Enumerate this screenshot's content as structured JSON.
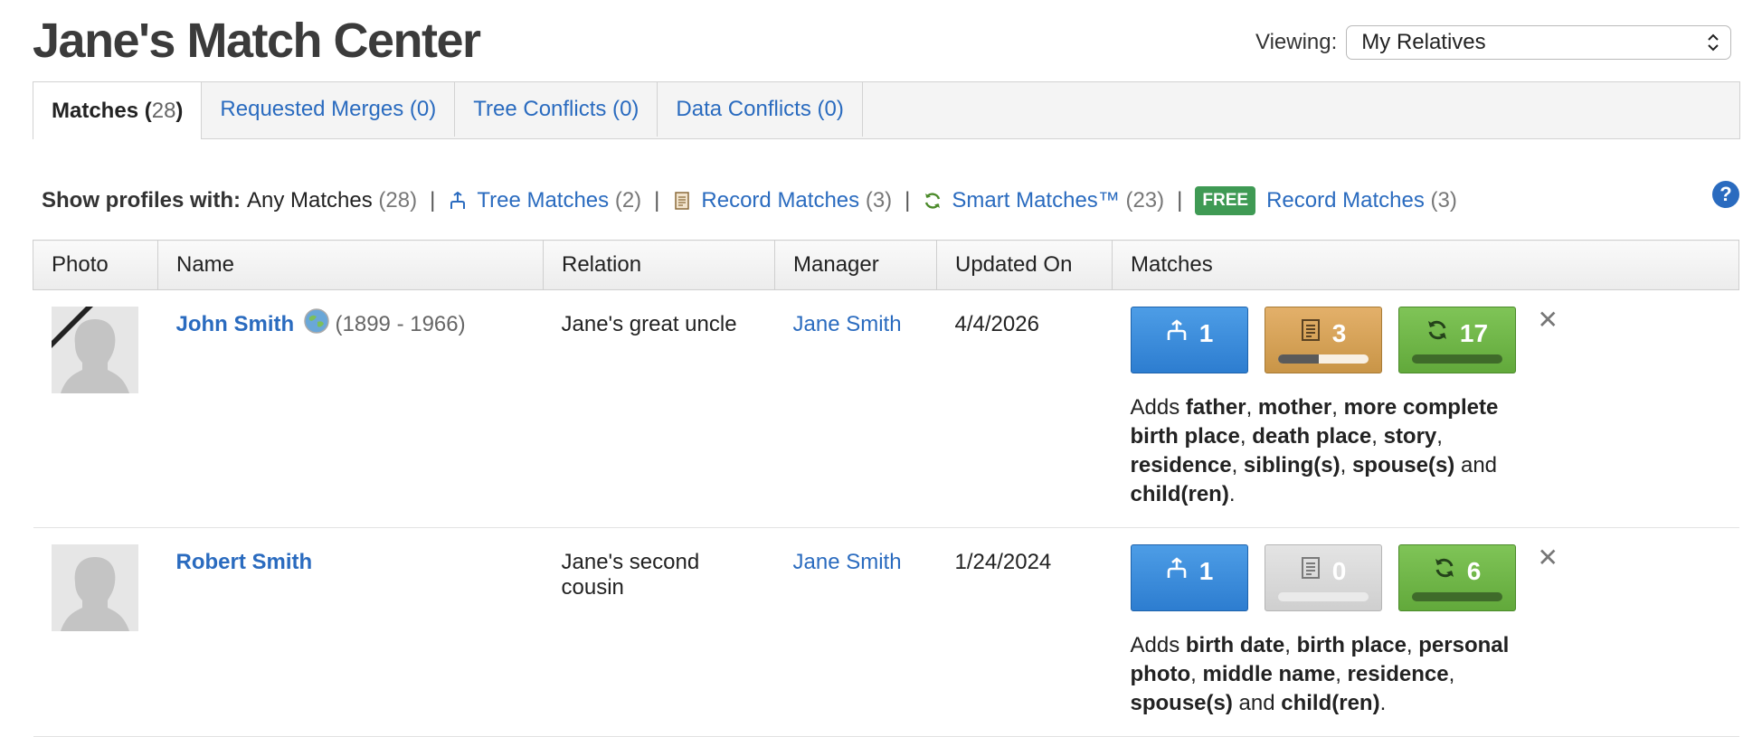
{
  "page_title": "Jane's Match Center",
  "viewing": {
    "label": "Viewing:",
    "selected": "My Relatives"
  },
  "tabs": [
    {
      "label": "Matches",
      "count": "28"
    },
    {
      "label": "Requested Merges",
      "count": "0"
    },
    {
      "label": "Tree Conflicts",
      "count": "0"
    },
    {
      "label": "Data Conflicts",
      "count": "0"
    }
  ],
  "filters": {
    "label": "Show profiles with:",
    "any": {
      "label": "Any Matches",
      "count": "(28)"
    },
    "tree": {
      "label": "Tree Matches",
      "count": "(2)"
    },
    "record": {
      "label": "Record Matches",
      "count": "(3)"
    },
    "smart": {
      "label": "Smart Matches™",
      "count": "(23)"
    },
    "free_badge": "FREE",
    "free_record": {
      "label": "Record Matches",
      "count": "(3)"
    },
    "separator": "|"
  },
  "help_label": "?",
  "table": {
    "headers": [
      "Photo",
      "Name",
      "Relation",
      "Manager",
      "Updated On",
      "Matches"
    ],
    "rows": [
      {
        "name": "John Smith",
        "years": "(1899 - 1966)",
        "deceased": true,
        "relation": "Jane's great uncle",
        "manager": "Jane Smith",
        "updated": "4/4/2026",
        "tree_matches": "1",
        "record_matches": "3",
        "record_progress": 0.45,
        "smart_matches": "17",
        "adds": [
          {
            "text": "Adds ",
            "b": false
          },
          {
            "text": "father",
            "b": true
          },
          {
            "text": ", ",
            "b": false
          },
          {
            "text": "mother",
            "b": true
          },
          {
            "text": ", ",
            "b": false
          },
          {
            "text": "more complete birth place",
            "b": true
          },
          {
            "text": ", ",
            "b": false
          },
          {
            "text": "death place",
            "b": true
          },
          {
            "text": ", ",
            "b": false
          },
          {
            "text": "story",
            "b": true
          },
          {
            "text": ", ",
            "b": false
          },
          {
            "text": "residence",
            "b": true
          },
          {
            "text": ", ",
            "b": false
          },
          {
            "text": "sibling(s)",
            "b": true
          },
          {
            "text": ", ",
            "b": false
          },
          {
            "text": "spouse(s)",
            "b": true
          },
          {
            "text": " and ",
            "b": false
          },
          {
            "text": "child(ren)",
            "b": true
          },
          {
            "text": ".",
            "b": false
          }
        ]
      },
      {
        "name": "Robert Smith",
        "years": "",
        "deceased": false,
        "relation": "Jane's second cousin",
        "manager": "Jane Smith",
        "updated": "1/24/2024",
        "tree_matches": "1",
        "record_matches": "0",
        "record_progress": 0,
        "smart_matches": "6",
        "adds": [
          {
            "text": "Adds ",
            "b": false
          },
          {
            "text": "birth date",
            "b": true
          },
          {
            "text": ", ",
            "b": false
          },
          {
            "text": "birth place",
            "b": true
          },
          {
            "text": ", ",
            "b": false
          },
          {
            "text": "personal photo",
            "b": true
          },
          {
            "text": ", ",
            "b": false
          },
          {
            "text": "middle name",
            "b": true
          },
          {
            "text": ", ",
            "b": false
          },
          {
            "text": "residence",
            "b": true
          },
          {
            "text": ", ",
            "b": false
          },
          {
            "text": "spouse(s)",
            "b": true
          },
          {
            "text": " and ",
            "b": false
          },
          {
            "text": "child(ren)",
            "b": true
          },
          {
            "text": ".",
            "b": false
          }
        ]
      }
    ]
  },
  "colors": {
    "link": "#2a6bbf",
    "tree": "#2d7dd0",
    "record": "#c99547",
    "smart": "#62a93b",
    "free": "#3f9a54"
  },
  "icons": {
    "tree": "tree-match-icon",
    "record": "record-document-icon",
    "smart": "smart-match-refresh-icon",
    "globe": "globe-icon",
    "close": "close-icon"
  },
  "close_glyph": "✕"
}
